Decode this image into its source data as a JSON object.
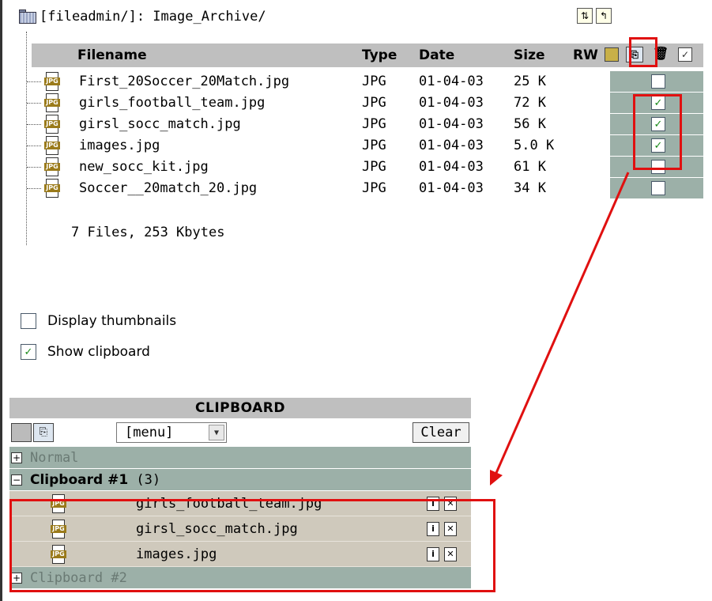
{
  "path": "[fileadmin/]: Image_Archive/",
  "toolbar": {
    "refresh_icon": "refresh-icon",
    "up_icon": "folder-up-icon"
  },
  "columns": {
    "filename": "Filename",
    "type": "Type",
    "date": "Date",
    "size": "Size",
    "rw": "RW"
  },
  "files": [
    {
      "name": "First_20Soccer_20Match.jpg",
      "type": "JPG",
      "date": "01-04-03",
      "size": "25 K",
      "checked": false
    },
    {
      "name": "girls_football_team.jpg",
      "type": "JPG",
      "date": "01-04-03",
      "size": "72 K",
      "checked": true
    },
    {
      "name": "girsl_socc_match.jpg",
      "type": "JPG",
      "date": "01-04-03",
      "size": "56 K",
      "checked": true
    },
    {
      "name": "images.jpg",
      "type": "JPG",
      "date": "01-04-03",
      "size": "5.0 K",
      "checked": true
    },
    {
      "name": "new_socc_kit.jpg",
      "type": "JPG",
      "date": "01-04-03",
      "size": "61 K",
      "checked": false
    },
    {
      "name": "Soccer__20match_20.jpg",
      "type": "JPG",
      "date": "01-04-03",
      "size": "34 K",
      "checked": false
    }
  ],
  "summary": "7 Files, 253 Kbytes",
  "options": {
    "display_thumbnails": {
      "label": "Display thumbnails",
      "checked": false
    },
    "show_clipboard": {
      "label": "Show clipboard",
      "checked": true
    }
  },
  "clipboard": {
    "title": "CLIPBOARD",
    "menu_value": "[menu]",
    "clear_label": "Clear",
    "normal_label": "Normal",
    "pad1_label": "Clipboard #1",
    "pad1_count": "(3)",
    "pad2_label": "Clipboard #2",
    "items": [
      "girls_football_team.jpg",
      "girsl_socc_match.jpg",
      "images.jpg"
    ]
  },
  "colors": {
    "highlight": "#e01010",
    "row_bg": "#9cb0a8",
    "item_bg": "#cfc9bc",
    "header_bg": "#bfbfbf"
  }
}
